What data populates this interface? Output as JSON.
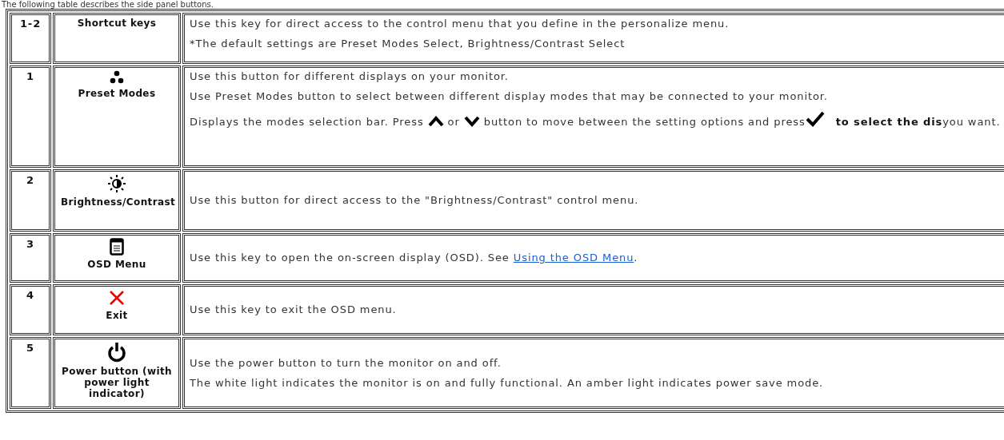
{
  "caption": "The following table describes the side panel buttons.",
  "rows": [
    {
      "number": "1-2",
      "label": "Shortcut keys",
      "paragraphs": [
        [
          {
            "kind": "text",
            "text": "Use this key for direct access to the control menu that you define in the personalize menu."
          }
        ],
        [
          {
            "kind": "text",
            "text": "*The default settings are Preset Modes Select, Brightness/Contrast Select"
          }
        ]
      ]
    },
    {
      "number": "1",
      "label": "Preset Modes",
      "paragraphs": [
        [
          {
            "kind": "text",
            "text": "Use this button for different displays on your monitor."
          }
        ],
        [
          {
            "kind": "text",
            "text": "Use Preset Modes button to select between different display modes that may be connected to your monitor."
          }
        ],
        [
          {
            "kind": "text",
            "text": "Displays the modes selection bar. Press "
          },
          {
            "kind": "icon"
          },
          {
            "kind": "text",
            "text": "or "
          },
          {
            "kind": "icon"
          },
          {
            "kind": "text",
            "text": "button to move between the setting options and press"
          },
          {
            "kind": "icon"
          },
          {
            "kind": "bold",
            "text": "to select the dis"
          },
          {
            "kind": "text",
            "text": "you want."
          }
        ]
      ]
    },
    {
      "number": "2",
      "label": "Brightness/Contrast",
      "paragraphs": [
        [
          {
            "kind": "text",
            "text": "Use this button for direct access to the \"Brightness/Contrast\" control menu."
          }
        ]
      ]
    },
    {
      "number": "3",
      "label": "OSD Menu",
      "paragraphs": [
        [
          {
            "kind": "text",
            "text": "Use this key to open the on-screen display (OSD). See "
          },
          {
            "kind": "link",
            "text": "Using the OSD Menu"
          },
          {
            "kind": "text",
            "text": "."
          }
        ]
      ]
    },
    {
      "number": "4",
      "label": "Exit",
      "paragraphs": [
        [
          {
            "kind": "text",
            "text": "Use this key to exit the OSD menu."
          }
        ]
      ]
    },
    {
      "number": "5",
      "label": "Power button **(with power light** indicator)",
      "paragraphs": [
        [
          {
            "kind": "text",
            "text": "Use the power button to turn the monitor on and off."
          }
        ],
        [
          {
            "kind": "text",
            "text": "The white light indicates the monitor is on and fully functional. An amber light indicates power save mode."
          }
        ]
      ]
    }
  ]
}
